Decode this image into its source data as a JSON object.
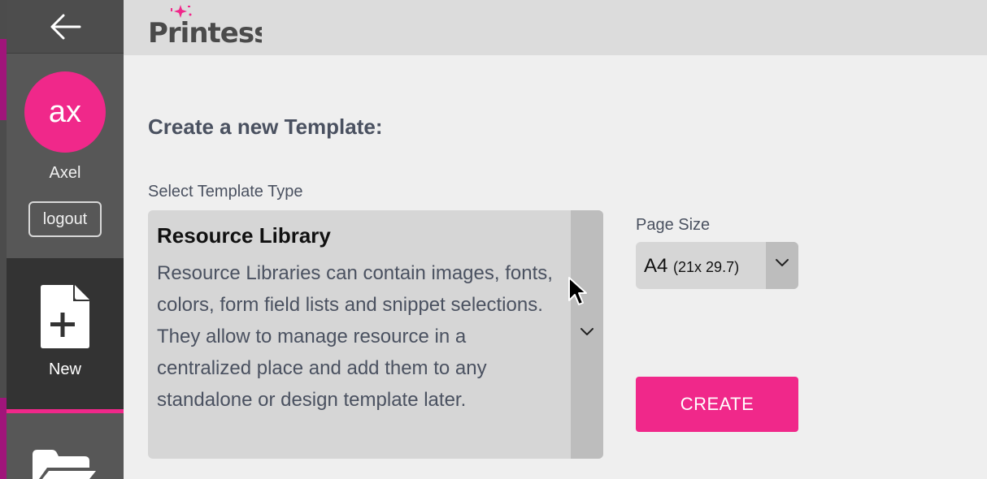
{
  "app": {
    "brand_name": "Printess"
  },
  "sidebar": {
    "user": {
      "initials": "ax",
      "name": "Axel"
    },
    "logout_label": "logout",
    "new_label": "New"
  },
  "form": {
    "title": "Create a new Template:",
    "template_type": {
      "label": "Select Template Type",
      "selected_title": "Resource Library",
      "selected_description": "Resource Libraries can contain images, fonts, colors, form field lists and snippet selections. They allow to manage resource in a centralized place and add them to any standalone or design template later."
    },
    "page_size": {
      "label": "Page Size",
      "selected_value": "A4",
      "selected_detail": "(21x 29.7)"
    },
    "create_label": "CREATE"
  },
  "colors": {
    "accent": "#f0288a",
    "sidebar_bg": "#575757",
    "sidebar_active_bg": "#333333",
    "header_bg": "#dcdcdc",
    "page_bg": "#efefef",
    "text_muted": "#4a5160"
  },
  "icons": {
    "back": "arrow-left-icon",
    "new": "file-plus-icon",
    "folder": "folder-icon",
    "dropdown": "chevron-down-icon",
    "cursor": "mouse-pointer-icon"
  }
}
